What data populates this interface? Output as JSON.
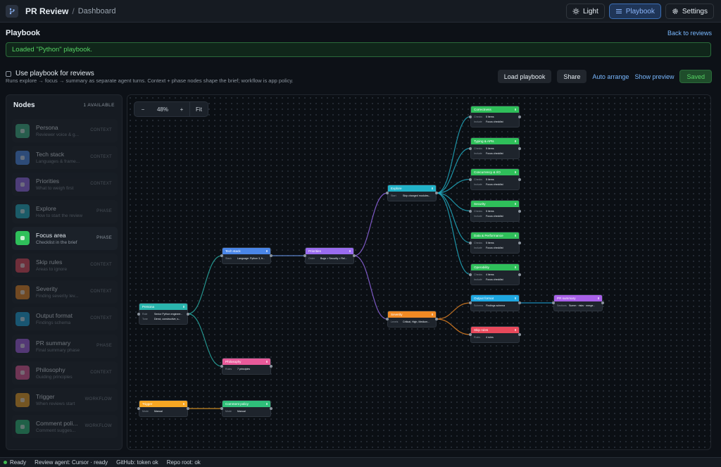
{
  "app": {
    "title": "PR Review",
    "breadcrumb": "Dashboard"
  },
  "header": {
    "light_label": "Light",
    "playbook_label": "Playbook",
    "settings_label": "Settings"
  },
  "playbook": {
    "title": "Playbook",
    "back_label": "Back to reviews",
    "banner": "Loaded \"Python\" playbook.",
    "use_label": "Use playbook for reviews",
    "use_checked": false,
    "use_desc": "Runs explore → focus → summary as separate agent turns. Context + phase nodes shape the brief; workflow is app policy.",
    "load_label": "Load playbook",
    "share_label": "Share",
    "auto_arrange_label": "Auto arrange",
    "show_preview_label": "Show preview",
    "saved_label": "Saved"
  },
  "palette": {
    "title": "Nodes",
    "count": "1 AVAILABLE",
    "items": [
      {
        "name": "Persona",
        "sub": "Reviewer voice & g...",
        "kind": "CONTEXT",
        "color": "#3fb98a",
        "enabled": false
      },
      {
        "name": "Tech stack",
        "sub": "Languages & frame...",
        "kind": "CONTEXT",
        "color": "#4d8ef0",
        "enabled": false
      },
      {
        "name": "Priorities",
        "sub": "What to weigh first",
        "kind": "CONTEXT",
        "color": "#9a6cf0",
        "enabled": false
      },
      {
        "name": "Explore",
        "sub": "How to start the review",
        "kind": "PHASE",
        "color": "#22b3c9",
        "enabled": false
      },
      {
        "name": "Focus area",
        "sub": "Checklist in the brief",
        "kind": "PHASE",
        "color": "#2fbf5a",
        "enabled": true
      },
      {
        "name": "Skip rules",
        "sub": "Areas to ignore",
        "kind": "CONTEXT",
        "color": "#e8495b",
        "enabled": false
      },
      {
        "name": "Severity",
        "sub": "Finding severity lev...",
        "kind": "CONTEXT",
        "color": "#f08a24",
        "enabled": false
      },
      {
        "name": "Output format",
        "sub": "Findings schema",
        "kind": "CONTEXT",
        "color": "#1ea7e1",
        "enabled": false
      },
      {
        "name": "PR summary",
        "sub": "Final summary phase",
        "kind": "PHASE",
        "color": "#a860e8",
        "enabled": false
      },
      {
        "name": "Philosophy",
        "sub": "Guiding principles",
        "kind": "CONTEXT",
        "color": "#e85a9a",
        "enabled": false
      },
      {
        "name": "Trigger",
        "sub": "When reviews start",
        "kind": "WORKFLOW",
        "color": "#f5a623",
        "enabled": false
      },
      {
        "name": "Comment poli...",
        "sub": "Comment sugges...",
        "kind": "WORKFLOW",
        "color": "#2fbf7a",
        "enabled": false
      }
    ]
  },
  "zoom": {
    "minus": "−",
    "level": "48%",
    "plus": "+",
    "fit": "Fit"
  },
  "nodes": {
    "persona": {
      "title": "Persona",
      "color": "#2ab5ad",
      "fields": [
        {
          "k": "Role",
          "v": "Senior Python engineer..."
        },
        {
          "k": "Tone",
          "v": "Direct, constructive, s..."
        }
      ]
    },
    "techstack": {
      "title": "Tech stack",
      "color": "#4a86e8",
      "fields": [
        {
          "k": "Stack",
          "v": "Language: Python 3, fr..."
        }
      ]
    },
    "priorities": {
      "title": "Priorities",
      "color": "#9a6cf0",
      "fields": [
        {
          "k": "Order",
          "v": "Bugs > Security > Rel..."
        }
      ]
    },
    "explore": {
      "title": "Explore",
      "color": "#22b3c9",
      "fields": [
        {
          "k": "Start",
          "v": "Skip changed modules..."
        }
      ]
    },
    "severity": {
      "title": "Severity",
      "color": "#f08a24",
      "fields": [
        {
          "k": "Levels",
          "v": "Critical, High, Medium..."
        }
      ]
    },
    "philosophy": {
      "title": "Philosophy",
      "color": "#e85a9a",
      "fields": [
        {
          "k": "Rules",
          "v": "7 principles"
        }
      ]
    },
    "trigger": {
      "title": "Trigger",
      "color": "#f5a623",
      "fields": [
        {
          "k": "Mode",
          "v": "Manual"
        }
      ]
    },
    "comment": {
      "title": "Comment policy",
      "color": "#2fbf7a",
      "fields": [
        {
          "k": "Mode",
          "v": "Manual"
        }
      ]
    },
    "correctness": {
      "title": "Correctness",
      "color": "#2fbf5a",
      "fields": [
        {
          "k": "Checks",
          "v": "5 items"
        },
        {
          "k": "Include",
          "v": "Focus checklist"
        }
      ]
    },
    "typing": {
      "title": "Typing & APIs",
      "color": "#2fbf5a",
      "fields": [
        {
          "k": "Checks",
          "v": "5 items"
        },
        {
          "k": "Include",
          "v": "Focus checklist"
        }
      ]
    },
    "concurrency": {
      "title": "Concurrency & I/O",
      "color": "#2fbf5a",
      "fields": [
        {
          "k": "Checks",
          "v": "5 items"
        },
        {
          "k": "Include",
          "v": "Focus checklist"
        }
      ]
    },
    "security": {
      "title": "Security",
      "color": "#2fbf5a",
      "fields": [
        {
          "k": "Checks",
          "v": "5 items"
        },
        {
          "k": "Include",
          "v": "Focus checklist"
        }
      ]
    },
    "data": {
      "title": "Data & Performance",
      "color": "#2fbf5a",
      "fields": [
        {
          "k": "Checks",
          "v": "5 items"
        },
        {
          "k": "Include",
          "v": "Focus checklist"
        }
      ]
    },
    "operability": {
      "title": "Operability",
      "color": "#2fbf5a",
      "fields": [
        {
          "k": "Checks",
          "v": "4 items"
        },
        {
          "k": "Include",
          "v": "Focus checklist"
        }
      ]
    },
    "output": {
      "title": "Output format",
      "color": "#1ea7e1",
      "fields": [
        {
          "k": "Schema",
          "v": "Findings schema"
        }
      ]
    },
    "skiprules": {
      "title": "Skip rules",
      "color": "#e8495b",
      "fields": [
        {
          "k": "Rules",
          "v": "4 rules"
        }
      ]
    },
    "prsummary": {
      "title": "PR summary",
      "color": "#a860e8",
      "fields": [
        {
          "k": "Sections",
          "v": "Summ · risks · merge..."
        }
      ]
    }
  },
  "status": {
    "ready": "Ready",
    "agent": "Review agent: Cursor · ready",
    "github": "GitHub: token ok",
    "repo": "Repo root: ok"
  }
}
